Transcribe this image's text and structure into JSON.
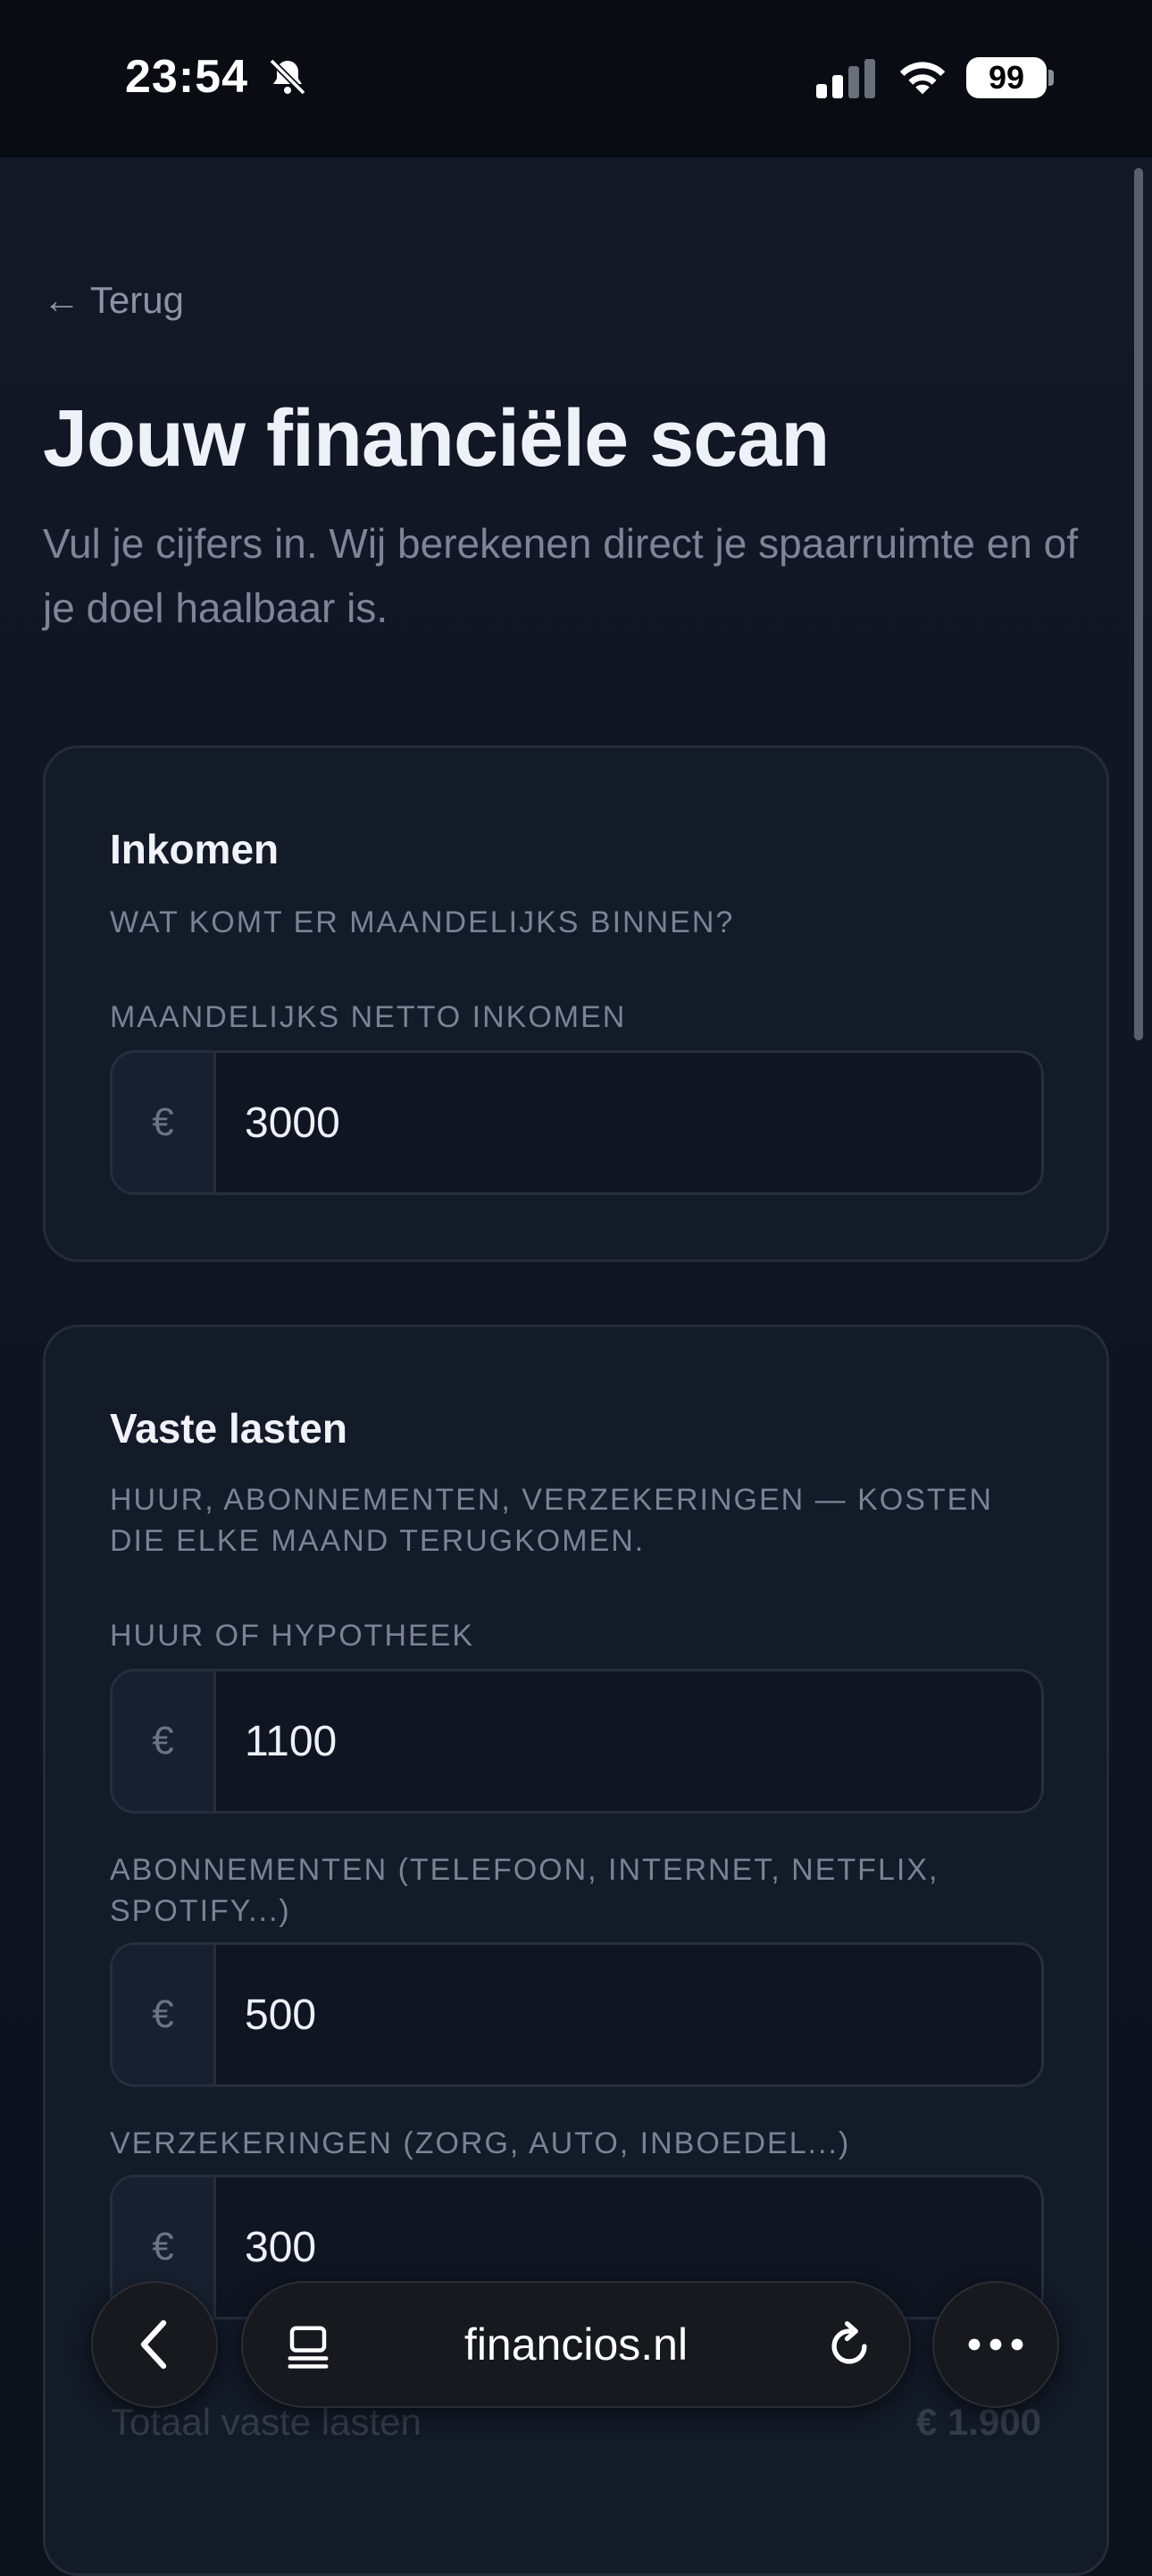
{
  "status_bar": {
    "time": "23:54",
    "battery": "99",
    "icons": [
      "bell-slash-icon",
      "signal-icon",
      "wifi-icon",
      "battery-icon"
    ]
  },
  "page": {
    "back_link": "← Terug",
    "title": "Jouw financiële scan",
    "subtitle": "Vul je cijfers in. Wij berekenen direct je spaarruimte en of je doel haalbaar is."
  },
  "income_card": {
    "title": "Inkomen",
    "caption": "Wat komt er maandelijks binnen?",
    "fields": [
      {
        "label": "Maandelijks netto inkomen",
        "prefix": "€",
        "value": "3000"
      }
    ]
  },
  "fixed_costs_card": {
    "title": "Vaste lasten",
    "caption": "Huur, abonnementen, verzekeringen — kosten die elke maand terugkomen.",
    "fields": [
      {
        "label": "Huur of hypotheek",
        "prefix": "€",
        "value": "1100"
      },
      {
        "label": "Abonnementen (telefoon, internet, Netflix, Spotify...)",
        "prefix": "€",
        "value": "500"
      },
      {
        "label": "Verzekeringen (zorg, auto, inboedel...)",
        "prefix": "€",
        "value": "300"
      }
    ],
    "total_label": "Totaal vaste lasten",
    "total_value": "€ 1.900"
  },
  "browser_bar": {
    "url": "financios.nl",
    "icons": [
      "chevron-left-icon",
      "tabs-icon",
      "reload-icon",
      "more-icon"
    ]
  },
  "colors": {
    "background": "#0d111b",
    "card": "#131a28",
    "card_border": "#242c3c",
    "muted_text": "#7a8295"
  }
}
